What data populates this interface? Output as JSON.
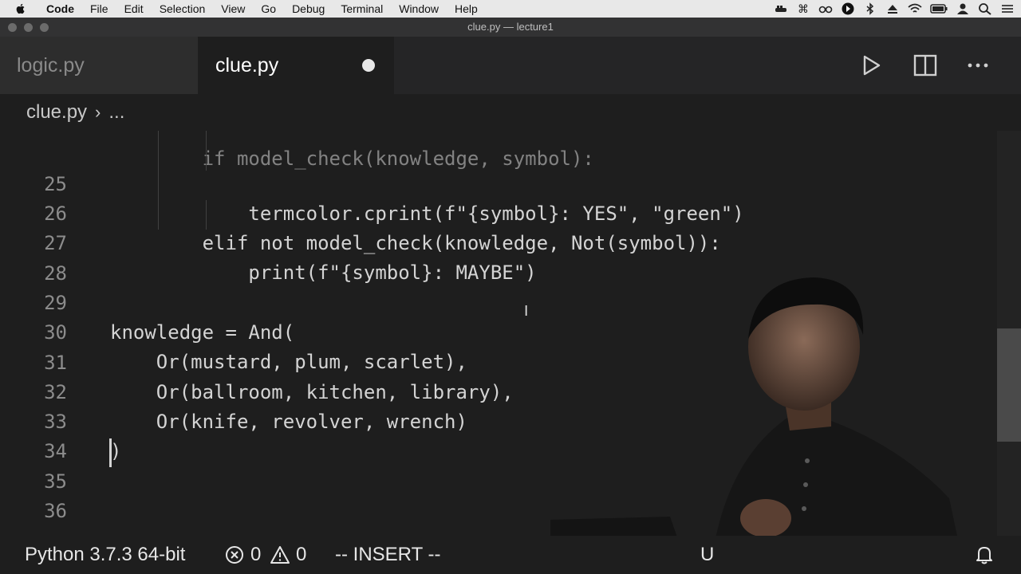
{
  "menubar": {
    "items": [
      "Code",
      "File",
      "Edit",
      "Selection",
      "View",
      "Go",
      "Debug",
      "Terminal",
      "Window",
      "Help"
    ]
  },
  "window": {
    "title": "clue.py — lecture1"
  },
  "tabs": [
    {
      "label": "logic.py",
      "active": false
    },
    {
      "label": "clue.py",
      "active": true,
      "unsaved": true
    }
  ],
  "breadcrumb": {
    "file": "clue.py",
    "ellipsis": "..."
  },
  "editor": {
    "partial_top_line": "        if model_check(knowledge, symbol):",
    "lines": [
      {
        "num": "25",
        "text": "            termcolor.cprint(f\"{symbol}: YES\", \"green\")"
      },
      {
        "num": "26",
        "text": "        elif not model_check(knowledge, Not(symbol)):"
      },
      {
        "num": "27",
        "text": "            print(f\"{symbol}: MAYBE\")"
      },
      {
        "num": "28",
        "text": ""
      },
      {
        "num": "29",
        "text": "knowledge = And("
      },
      {
        "num": "30",
        "text": "    Or(mustard, plum, scarlet),"
      },
      {
        "num": "31",
        "text": "    Or(ballroom, kitchen, library),"
      },
      {
        "num": "32",
        "text": "    Or(knife, revolver, wrench)"
      },
      {
        "num": "33",
        "text": ")"
      },
      {
        "num": "34",
        "text": ""
      },
      {
        "num": "35",
        "text": ""
      },
      {
        "num": "36",
        "text": ""
      }
    ]
  },
  "statusbar": {
    "interpreter": "Python 3.7.3 64-bit",
    "errors": "0",
    "warnings": "0",
    "mode": "-- INSERT --",
    "partial_text": "U"
  },
  "icons": {
    "run": "play-icon",
    "split": "split-editor-icon",
    "more": "more-actions-icon",
    "bell": "bell-icon",
    "errors": "error-circle-icon",
    "warnings": "warning-triangle-icon"
  },
  "colors": {
    "editor_bg": "#1e1e1e",
    "tabbar_bg": "#252526",
    "text": "#d4d4d4"
  }
}
